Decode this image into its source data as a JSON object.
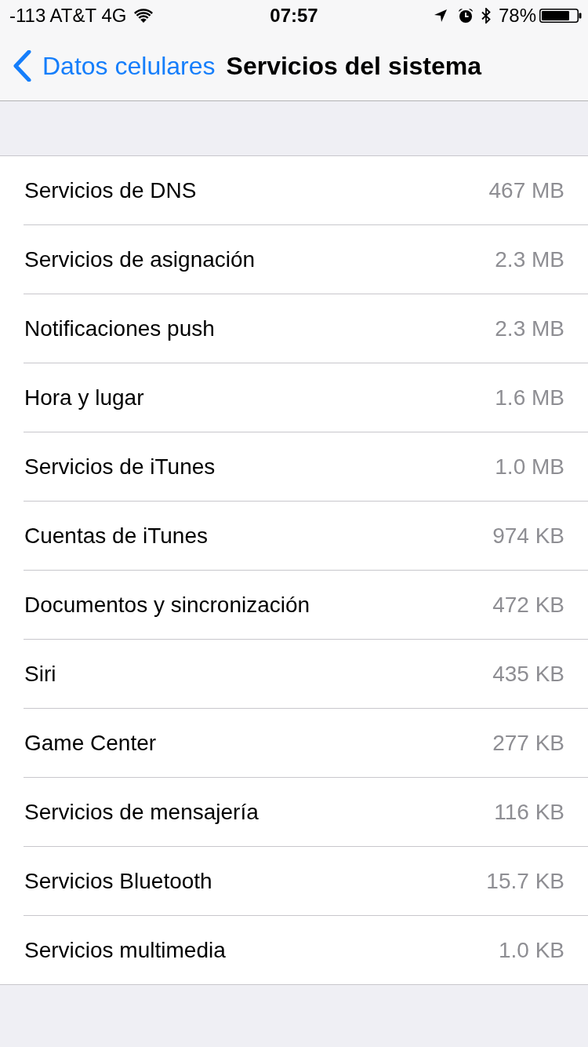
{
  "status_bar": {
    "carrier": "-113 AT&T 4G",
    "time": "07:57",
    "battery_percent": "78%"
  },
  "nav_bar": {
    "back_label": "Datos celulares",
    "title": "Servicios del sistema"
  },
  "services": [
    {
      "name": "Servicios de DNS",
      "usage": "467 MB"
    },
    {
      "name": "Servicios de asignación",
      "usage": "2.3 MB"
    },
    {
      "name": "Notificaciones push",
      "usage": "2.3 MB"
    },
    {
      "name": "Hora y lugar",
      "usage": "1.6 MB"
    },
    {
      "name": "Servicios de iTunes",
      "usage": "1.0 MB"
    },
    {
      "name": "Cuentas de iTunes",
      "usage": "974 KB"
    },
    {
      "name": "Documentos y sincronización",
      "usage": "472 KB"
    },
    {
      "name": "Siri",
      "usage": "435 KB"
    },
    {
      "name": "Game Center",
      "usage": "277 KB"
    },
    {
      "name": "Servicios de mensajería",
      "usage": "116 KB"
    },
    {
      "name": "Servicios Bluetooth",
      "usage": "15.7 KB"
    },
    {
      "name": "Servicios multimedia",
      "usage": "1.0 KB"
    }
  ]
}
